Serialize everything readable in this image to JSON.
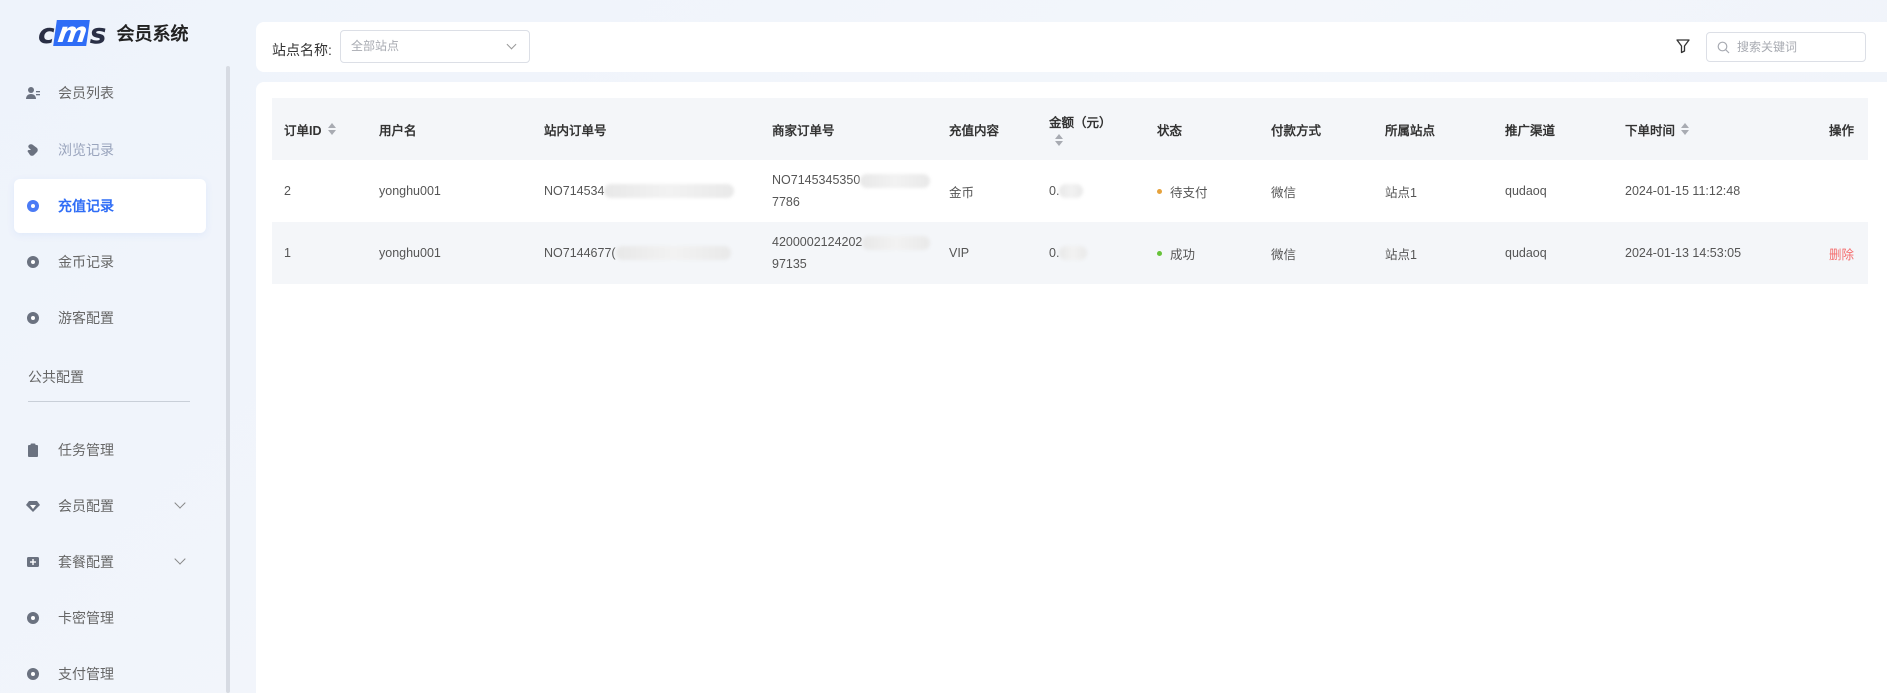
{
  "brand": {
    "logo_mark_left": "c",
    "logo_mark_mid": "m",
    "logo_mark_right": "s",
    "title": "会员系统"
  },
  "sidebar": {
    "items": [
      {
        "label": "会员列表",
        "icon": "user-list-icon"
      },
      {
        "label": "浏览记录",
        "icon": "hand-icon"
      },
      {
        "label": "充值记录",
        "icon": "circle-dot-icon",
        "active": true
      },
      {
        "label": "金币记录",
        "icon": "circle-dot-icon"
      },
      {
        "label": "游客配置",
        "icon": "circle-dot-icon"
      }
    ],
    "section_label": "公共配置",
    "items2": [
      {
        "label": "任务管理",
        "icon": "clipboard-icon"
      },
      {
        "label": "会员配置",
        "icon": "gem-icon"
      },
      {
        "label": "套餐配置",
        "icon": "package-icon"
      },
      {
        "label": "卡密管理",
        "icon": "circle-dot-icon"
      },
      {
        "label": "支付管理",
        "icon": "circle-dot-icon"
      }
    ]
  },
  "filter": {
    "site_label": "站点名称:",
    "site_value": "全部站点",
    "search_placeholder": "搜索关键词"
  },
  "table": {
    "columns": [
      "订单ID",
      "用户名",
      "站内订单号",
      "商家订单号",
      "充值内容",
      "金额（元）",
      "状态",
      "付款方式",
      "所属站点",
      "推广渠道",
      "下单时间",
      "操作"
    ],
    "rows": [
      {
        "id": "2",
        "username": "yonghu001",
        "site_order": "NO714534",
        "merchant_order_1": "NO7145345350",
        "merchant_order_2": "7786",
        "content": "金币",
        "amount": "0.",
        "status": "待支付",
        "status_color": "#e6a23c",
        "payment": "微信",
        "site": "站点1",
        "channel": "qudaoq",
        "time": "2024-01-15 11:12:48",
        "action": ""
      },
      {
        "id": "1",
        "username": "yonghu001",
        "site_order": "NO7144677(",
        "merchant_order_1": "4200002124202",
        "merchant_order_2": "97135",
        "content": "VIP",
        "amount": "0.",
        "status": "成功",
        "status_color": "#67c23a",
        "payment": "微信",
        "site": "站点1",
        "channel": "qudaoq",
        "time": "2024-01-13 14:53:05",
        "action": "删除"
      }
    ]
  },
  "colors": {
    "accent": "#2f6df6",
    "danger": "#f56c6c"
  }
}
